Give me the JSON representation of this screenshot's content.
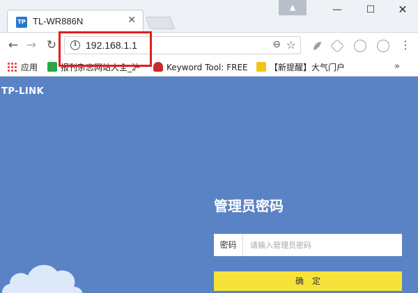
{
  "browser": {
    "tab_title": "TL-WR886N",
    "tab_favicon": "TP",
    "url": "192.168.1.1",
    "bookmarks": [
      {
        "label": "应用"
      },
      {
        "label": "报刊杂志网站大全_沪"
      },
      {
        "label": "Keyword Tool: FREE"
      },
      {
        "label": "【新提醒】大气门户"
      }
    ]
  },
  "page": {
    "logo_text": "TP-LINK",
    "login_title": "管理员密码",
    "password_label": "密码",
    "password_placeholder": "请输入管理员密码",
    "confirm_label": "确定"
  },
  "colors": {
    "page_background": "#5a83c5",
    "confirm_button": "#f6e33a",
    "highlight_box": "#e11d1d"
  }
}
